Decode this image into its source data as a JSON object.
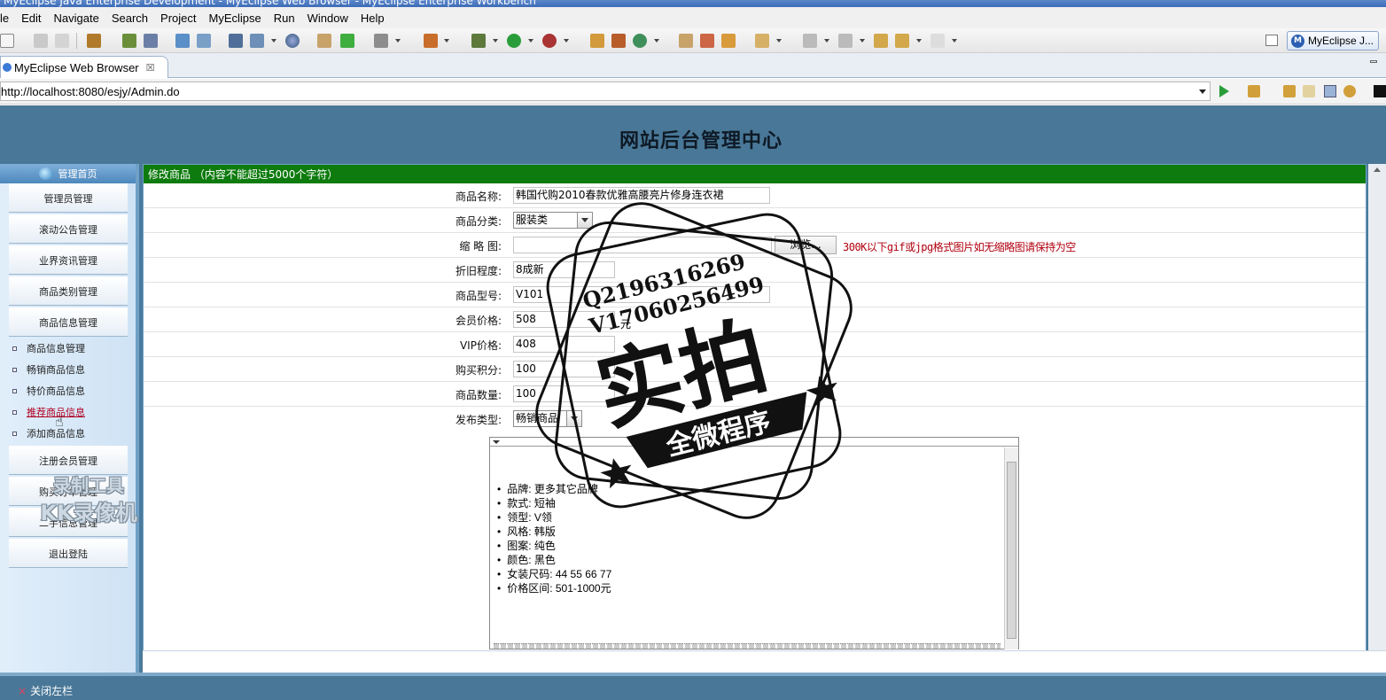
{
  "window": {
    "title": "MyEclipse Java Enterprise Development - MyEclipse Web Browser - MyEclipse Enterprise Workbench"
  },
  "menu": [
    "le",
    "Edit",
    "Navigate",
    "Search",
    "Project",
    "MyEclipse",
    "Run",
    "Window",
    "Help"
  ],
  "perspective": {
    "label": "MyEclipse J..."
  },
  "tab": {
    "label": "MyEclipse Web Browser",
    "close": "☒"
  },
  "address": {
    "url": "http://localhost:8080/esjy/Admin.do"
  },
  "page": {
    "title": "网站后台管理中心",
    "sidebar": {
      "home": "管理首页",
      "buttons": [
        "管理员管理",
        "滚动公告管理",
        "业界资讯管理",
        "商品类别管理",
        "商品信息管理"
      ],
      "subitems": [
        "商品信息管理",
        "畅销商品信息",
        "特价商品信息",
        "推荐商品信息",
        "添加商品信息"
      ],
      "buttons2": [
        "注册会员管理",
        "购买订单管理",
        "二手信息管理",
        "退出登陆"
      ]
    },
    "form": {
      "header": "修改商品 （内容不能超过5000个字符）",
      "fields": [
        {
          "label": "商品名称:",
          "value": "韩国代购2010春款优雅高腰亮片修身连衣裙"
        },
        {
          "label": "商品分类:",
          "value": "服装类"
        },
        {
          "label": "缩 略 图:",
          "value": ""
        },
        {
          "label": "折旧程度:",
          "value": "8成新"
        },
        {
          "label": "商品型号:",
          "value": "V101"
        },
        {
          "label": "会员价格:",
          "value": "508"
        },
        {
          "label": "VIP价格:",
          "value": "408"
        },
        {
          "label": "购买积分:",
          "value": "100"
        },
        {
          "label": "商品数量:",
          "value": "100"
        },
        {
          "label": "发布类型:",
          "value": "畅销商品"
        }
      ],
      "browse_label": "浏览...",
      "thumb_hint": "300K以下gif或jpg格式图片如无缩略图请保持为空",
      "price_unit": "元",
      "description": [
        "品牌: 更多其它品牌",
        "款式: 短袖",
        "领型: V领",
        "风格: 韩版",
        "图案: 纯色",
        "颜色: 黑色",
        "女装尺码: 44 55 66 77",
        "价格区间: 501-1000元"
      ]
    },
    "footer_close": "关闭左栏"
  },
  "watermarks": {
    "recorder_line1": "录制工具",
    "recorder_line2": "KK录像机",
    "stamp_qq": "Q2196316269",
    "stamp_v": "V17060256499",
    "stamp_main": "实拍",
    "stamp_banner": "全微程序"
  }
}
